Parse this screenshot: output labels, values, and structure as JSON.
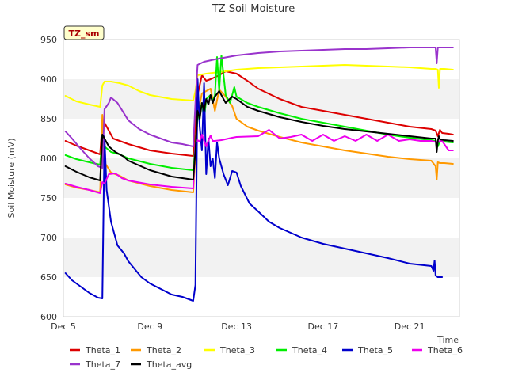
{
  "chart_data": {
    "type": "line",
    "title": "TZ Soil Moisture",
    "site_badge": "TZ_sm",
    "xlabel": "Time",
    "ylabel": "Soil Moisture (mV)",
    "xlim": [
      5,
      23.3
    ],
    "ylim": [
      600,
      950
    ],
    "x_ticks": [
      5,
      9,
      13,
      17,
      21
    ],
    "x_tick_labels": [
      "Dec 5",
      "Dec 9",
      "Dec 13",
      "Dec 17",
      "Dec 21"
    ],
    "y_ticks": [
      600,
      650,
      700,
      750,
      800,
      850,
      900,
      950
    ],
    "y_tick_labels": [
      "600",
      "650",
      "700",
      "750",
      "800",
      "850",
      "900",
      "950"
    ],
    "grid": "horizontal bands",
    "legend_position": "bottom",
    "series": [
      {
        "name": "Theta_1",
        "color": "#dd0000",
        "x": [
          5.1,
          5.6,
          6.2,
          6.7,
          6.8,
          6.9,
          7.3,
          8.0,
          9.0,
          10.0,
          11.0,
          11.2,
          11.4,
          11.6,
          11.8,
          12.2,
          12.5,
          13.0,
          13.5,
          14.0,
          15.0,
          16.0,
          17.0,
          18.0,
          19.0,
          20.0,
          21.0,
          22.0,
          22.2,
          22.3,
          22.4,
          22.5,
          22.8,
          23.0
        ],
        "values": [
          822,
          816,
          810,
          805,
          845,
          845,
          825,
          818,
          810,
          806,
          803,
          880,
          905,
          898,
          900,
          905,
          910,
          907,
          898,
          888,
          875,
          865,
          860,
          855,
          850,
          845,
          840,
          837,
          835,
          828,
          836,
          832,
          831,
          830
        ]
      },
      {
        "name": "Theta_2",
        "color": "#ff9900",
        "x": [
          5.1,
          5.6,
          6.2,
          6.7,
          6.8,
          6.9,
          7.2,
          7.6,
          8.0,
          9.0,
          10.0,
          11.0,
          11.2,
          11.4,
          11.6,
          11.8,
          12.0,
          12.2,
          12.5,
          12.8,
          13.0,
          13.5,
          14.0,
          15.0,
          16.0,
          17.0,
          18.0,
          19.0,
          20.0,
          21.0,
          22.0,
          22.2,
          22.25,
          22.3,
          22.4,
          22.6,
          23.0
        ],
        "values": [
          767,
          763,
          760,
          757,
          855,
          795,
          782,
          778,
          772,
          765,
          760,
          757,
          855,
          882,
          885,
          888,
          860,
          887,
          878,
          866,
          850,
          840,
          835,
          827,
          820,
          815,
          810,
          806,
          802,
          799,
          797,
          790,
          773,
          795,
          794,
          794,
          793
        ]
      },
      {
        "name": "Theta_3",
        "color": "#ffff00",
        "x": [
          5.1,
          5.6,
          6.2,
          6.7,
          6.8,
          6.9,
          7.2,
          7.6,
          8.0,
          8.5,
          9.0,
          10.0,
          11.0,
          11.1,
          11.2,
          11.4,
          11.6,
          11.9,
          12.5,
          13.0,
          14.0,
          15.0,
          16.0,
          17.0,
          18.0,
          19.0,
          20.0,
          21.0,
          22.0,
          22.2,
          22.3,
          22.35,
          22.4,
          22.6,
          23.0
        ],
        "values": [
          879,
          872,
          868,
          865,
          892,
          897,
          897,
          895,
          892,
          885,
          880,
          875,
          873,
          885,
          905,
          906,
          907,
          908,
          910,
          912,
          914,
          915,
          916,
          917,
          918,
          917,
          916,
          915,
          913,
          913,
          912,
          889,
          913,
          913,
          912
        ]
      },
      {
        "name": "Theta_4",
        "color": "#00ee00",
        "x": [
          5.1,
          5.6,
          6.2,
          6.7,
          6.8,
          6.9,
          7.2,
          7.6,
          8.0,
          9.0,
          10.0,
          11.0,
          11.2,
          11.4,
          11.5,
          11.6,
          11.8,
          11.9,
          12.0,
          12.1,
          12.2,
          12.3,
          12.5,
          12.7,
          12.9,
          13.0,
          13.5,
          14.0,
          15.0,
          16.0,
          17.0,
          18.0,
          19.0,
          20.0,
          21.0,
          22.0,
          22.2,
          22.3,
          22.4,
          22.6,
          23.0
        ],
        "values": [
          804,
          799,
          795,
          792,
          828,
          815,
          808,
          805,
          800,
          793,
          788,
          785,
          850,
          870,
          848,
          875,
          880,
          872,
          880,
          928,
          885,
          930,
          880,
          870,
          890,
          878,
          870,
          865,
          857,
          850,
          845,
          840,
          835,
          830,
          826,
          823,
          822,
          815,
          822,
          821,
          820
        ]
      },
      {
        "name": "Theta_5",
        "color": "#0000cc",
        "x": [
          5.1,
          5.4,
          5.8,
          6.2,
          6.6,
          6.8,
          6.9,
          7.0,
          7.2,
          7.5,
          7.8,
          8.0,
          8.3,
          8.6,
          9.0,
          9.5,
          10.0,
          10.5,
          10.8,
          11.0,
          11.1,
          11.2,
          11.3,
          11.4,
          11.5,
          11.6,
          11.7,
          11.8,
          11.9,
          12.0,
          12.1,
          12.2,
          12.4,
          12.6,
          12.8,
          13.0,
          13.2,
          13.6,
          14.0,
          14.5,
          15.0,
          15.5,
          16.0,
          17.0,
          18.0,
          19.0,
          20.0,
          21.0,
          22.0,
          22.1,
          22.15,
          22.2,
          22.3,
          22.5
        ],
        "values": [
          655,
          646,
          638,
          630,
          624,
          623,
          828,
          760,
          720,
          690,
          680,
          670,
          660,
          650,
          642,
          635,
          628,
          625,
          622,
          620,
          640,
          900,
          840,
          810,
          895,
          780,
          825,
          790,
          800,
          775,
          820,
          800,
          780,
          766,
          784,
          782,
          765,
          743,
          733,
          720,
          712,
          706,
          700,
          692,
          686,
          680,
          674,
          667,
          664,
          658,
          671,
          652,
          650,
          650
        ]
      },
      {
        "name": "Theta_6",
        "color": "#ee00ee",
        "x": [
          5.1,
          5.6,
          6.2,
          6.7,
          6.8,
          6.9,
          7.1,
          7.4,
          7.7,
          8.0,
          9.0,
          10.0,
          11.0,
          11.1,
          11.2,
          11.3,
          11.4,
          11.6,
          11.8,
          11.9,
          12.0,
          12.3,
          12.8,
          13.0,
          14.0,
          14.5,
          15.0,
          15.5,
          16.0,
          16.5,
          17.0,
          17.5,
          18.0,
          18.5,
          19.0,
          19.5,
          20.0,
          20.5,
          21.0,
          21.5,
          22.0,
          22.3,
          22.4,
          22.5,
          22.8,
          23.0
        ],
        "values": [
          768,
          764,
          760,
          756,
          770,
          768,
          780,
          781,
          775,
          772,
          767,
          764,
          762,
          820,
          823,
          821,
          830,
          815,
          829,
          822,
          822,
          823,
          826,
          827,
          828,
          836,
          825,
          827,
          830,
          822,
          830,
          822,
          828,
          822,
          830,
          822,
          830,
          822,
          824,
          822,
          822,
          820,
          822,
          822,
          810,
          810
        ]
      },
      {
        "name": "Theta_7",
        "color": "#9933cc",
        "x": [
          5.1,
          5.4,
          5.8,
          6.2,
          6.6,
          6.8,
          6.9,
          7.1,
          7.2,
          7.5,
          8.0,
          8.5,
          9.0,
          10.0,
          10.5,
          11.0,
          11.1,
          11.2,
          11.5,
          12.0,
          13.0,
          14.0,
          15.0,
          16.0,
          17.0,
          18.0,
          19.0,
          20.0,
          21.0,
          22.0,
          22.2,
          22.25,
          22.3,
          23.0
        ],
        "values": [
          834,
          825,
          812,
          800,
          790,
          788,
          862,
          870,
          877,
          870,
          848,
          837,
          830,
          820,
          818,
          815,
          870,
          918,
          922,
          925,
          930,
          933,
          935,
          936,
          937,
          938,
          938,
          939,
          940,
          940,
          940,
          920,
          940,
          940
        ]
      },
      {
        "name": "Theta_avg",
        "color": "#000000",
        "x": [
          5.1,
          5.6,
          6.2,
          6.7,
          6.8,
          6.9,
          7.1,
          7.4,
          7.8,
          8.0,
          9.0,
          10.0,
          11.0,
          11.1,
          11.2,
          11.3,
          11.4,
          11.5,
          11.6,
          11.7,
          11.8,
          11.9,
          12.0,
          12.2,
          12.5,
          12.8,
          13.0,
          13.5,
          14.0,
          15.0,
          16.0,
          17.0,
          18.0,
          19.0,
          20.0,
          21.0,
          22.0,
          22.2,
          22.25,
          22.3,
          22.35,
          22.4,
          22.6,
          23.0
        ],
        "values": [
          790,
          783,
          776,
          772,
          830,
          825,
          815,
          808,
          802,
          797,
          785,
          777,
          773,
          810,
          860,
          850,
          870,
          860,
          875,
          868,
          880,
          870,
          878,
          885,
          870,
          878,
          875,
          865,
          860,
          852,
          846,
          841,
          837,
          834,
          831,
          828,
          825,
          825,
          808,
          822,
          828,
          824,
          823,
          822
        ]
      }
    ]
  }
}
